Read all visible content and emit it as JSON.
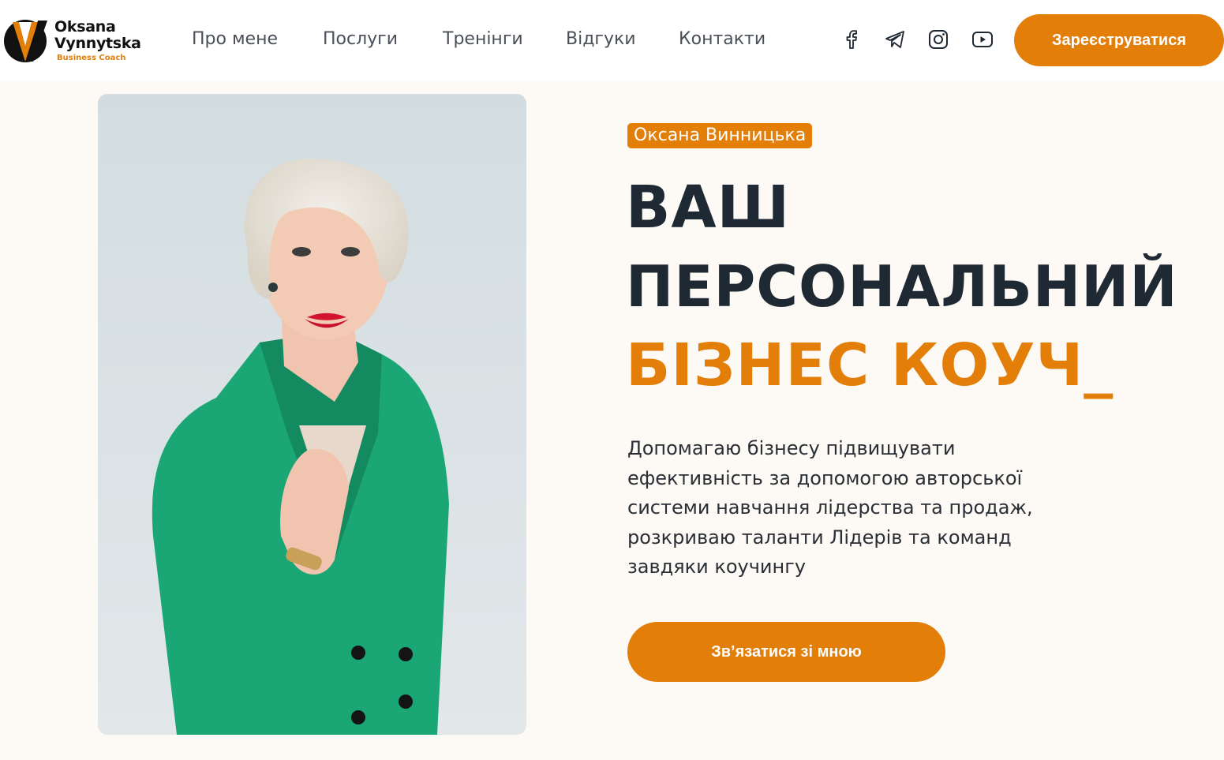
{
  "brand": {
    "name_line1": "Oksana",
    "name_line2": "Vynnytska",
    "tagline": "Business Coach",
    "accent_color": "#e37e09"
  },
  "nav": {
    "items": [
      {
        "label": "Про мене"
      },
      {
        "label": "Послуги"
      },
      {
        "label": "Тренінги"
      },
      {
        "label": "Відгуки"
      },
      {
        "label": "Контакти"
      }
    ]
  },
  "social": {
    "icons": [
      "facebook-icon",
      "telegram-icon",
      "instagram-icon",
      "youtube-icon"
    ]
  },
  "header": {
    "register_label": "Зареєструватися"
  },
  "hero": {
    "name_badge": "Оксана Винницька",
    "headline_line1": "ВАШ",
    "headline_line2": "ПЕРСОНАЛЬНИЙ",
    "headline_line3": "БІЗНЕС КОУЧ_",
    "description": "Допомагаю бізнесу підвищувати ефективність за допомогою авторської системи навчання лідерства та продаж, розкриваю таланти Лідерів та команд завдяки коучингу",
    "cta_label": "Зв’язатися зі мною",
    "photo": "portrait of a smiling woman in a green blazer"
  }
}
